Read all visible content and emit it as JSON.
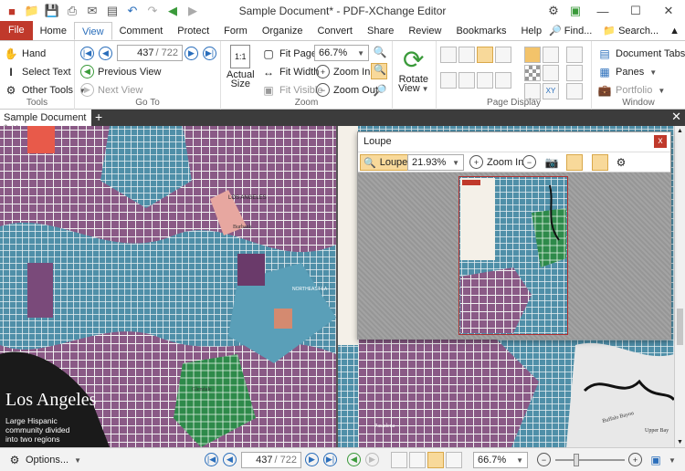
{
  "window": {
    "title": "Sample Document* - PDF-XChange Editor"
  },
  "menu": {
    "tabs": [
      "File",
      "Home",
      "View",
      "Comment",
      "Protect",
      "Form",
      "Organize",
      "Convert",
      "Share",
      "Review",
      "Bookmarks",
      "Help"
    ],
    "active": "View",
    "find_label": "Find...",
    "search_label": "Search..."
  },
  "ribbon": {
    "tools": {
      "hand": "Hand",
      "select_text": "Select Text",
      "other_tools": "Other Tools",
      "label": "Tools"
    },
    "goto": {
      "page_value": "437",
      "page_total": "/ 722",
      "previous_view": "Previous View",
      "next_view": "Next View",
      "label": "Go To"
    },
    "zoom": {
      "actual_size_1": "Actual",
      "actual_size_2": "Size",
      "fit_page": "Fit Page",
      "fit_width": "Fit Width",
      "fit_visible": "Fit Visible",
      "zoom_value": "66.7%",
      "zoom_in": "Zoom In",
      "zoom_out": "Zoom Out",
      "label": "Zoom"
    },
    "rotate": {
      "label1": "Rotate",
      "label2": "View"
    },
    "page_display": {
      "label": "Page Display"
    },
    "window": {
      "document_tabs": "Document Tabs",
      "panes": "Panes",
      "portfolio": "Portfolio",
      "label": "Window"
    }
  },
  "document_tab": {
    "name": "Sample Document *"
  },
  "map": {
    "title": "Los Angeles",
    "subtitle_1": "Large Hispanic",
    "subtitle_2": "community divided",
    "subtitle_3": "into two regions",
    "labels": [
      "LOS ANGELES",
      "NORTHEAST LA",
      "Burbank",
      "Glendale",
      "Pasadena",
      "Upper Bay",
      "Buffalo Bayou"
    ]
  },
  "loupe": {
    "title": "Loupe",
    "loupe_button": "Loupe",
    "zoom_value": "21.93%",
    "zoom_in": "Zoom In"
  },
  "status": {
    "options": "Options...",
    "page_value": "437",
    "page_total": "/ 722",
    "zoom_value": "66.7%"
  },
  "colors": {
    "file_tab": "#c0392b",
    "accent": "#2a6ebb",
    "dark_bg": "#3c3c3c"
  }
}
